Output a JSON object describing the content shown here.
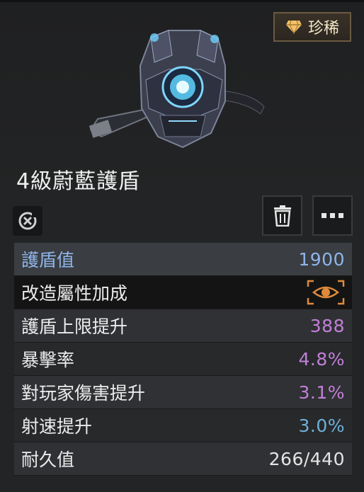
{
  "rarity": {
    "label": "珍稀",
    "icon": "diamond-icon",
    "color": "#f3c16a"
  },
  "item": {
    "name": "4級蔚藍護盾",
    "image": "blue-armor-vest"
  },
  "actions": {
    "recycle_icon": "recycle-icon",
    "trash_icon": "trash-icon",
    "more_icon": "more-icon"
  },
  "stats": {
    "shield": {
      "label": "護盾值",
      "value": "1900"
    },
    "mods": {
      "label": "改造屬性加成",
      "icon": "eye-icon"
    },
    "cap": {
      "label": "護盾上限提升",
      "value": "388"
    },
    "crit": {
      "label": "暴擊率",
      "value": "4.8%"
    },
    "pvp": {
      "label": "對玩家傷害提升",
      "value": "3.1%"
    },
    "rof": {
      "label": "射速提升",
      "value": "3.0%"
    },
    "durability": {
      "label": "耐久值",
      "value": "266/440"
    }
  },
  "colors": {
    "accent_blue": "#8fb5ea",
    "stat_pink": "#c27fd8",
    "stat_blue": "#6fb0d8",
    "eye_orange": "#e08a3a"
  }
}
